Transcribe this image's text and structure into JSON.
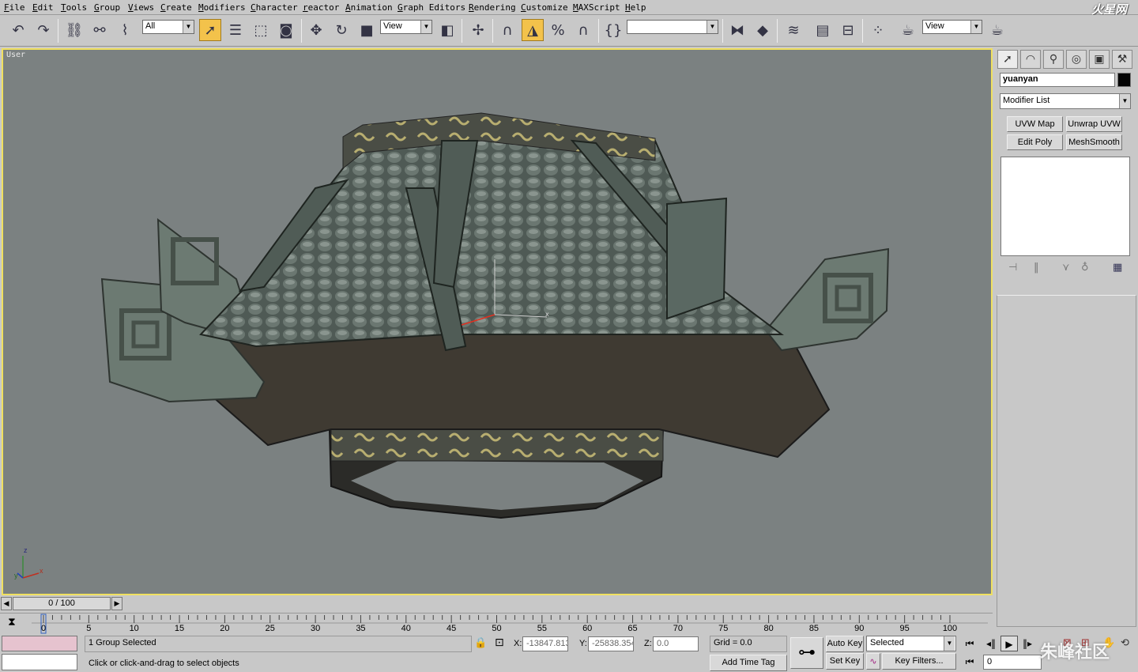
{
  "menu": [
    "File",
    "Edit",
    "Tools",
    "Group",
    "Views",
    "Create",
    "Modifiers",
    "Character",
    "reactor",
    "Animation",
    "Graph Editors",
    "Rendering",
    "Customize",
    "MAXScript",
    "Help"
  ],
  "logo_text": "火星网",
  "toolbar": {
    "selection_filter": "All",
    "ref_coord_1": "View",
    "named_sel": "",
    "ref_coord_2": "View",
    "icons": [
      "undo-icon",
      "redo-icon",
      "select-link-icon",
      "unlink-icon",
      "bind-space-warp-icon",
      "select-object-icon",
      "select-by-name-icon",
      "rect-region-icon",
      "window-crossing-icon",
      "move-icon",
      "rotate-icon",
      "scale-icon",
      "pivot-icon",
      "manipulate-icon",
      "snap-icon",
      "angle-snap-icon",
      "percent-snap-icon",
      "spinner-snap-icon",
      "edit-named-sel-icon",
      "mirror-icon",
      "align-icon",
      "layer-icon",
      "curve-editor-icon",
      "schematic-icon",
      "material-editor-icon",
      "render-scene-icon",
      "quick-render-icon"
    ]
  },
  "viewport": {
    "label": "User",
    "axis_x": "x",
    "axis_y": "y",
    "axis_z": "z"
  },
  "command_panel": {
    "object_name": "yuanyan",
    "object_color": "#050505",
    "modifier_list": "Modifier List",
    "modifier_buttons": [
      "UVW Map",
      "Unwrap UVW",
      "Edit Poly",
      "MeshSmooth"
    ]
  },
  "time_slider": {
    "label": "0 / 100",
    "current": 0,
    "total": 100
  },
  "track_ticks": [
    "0",
    "5",
    "10",
    "15",
    "20",
    "25",
    "30",
    "35",
    "40",
    "45",
    "50",
    "55",
    "60",
    "65",
    "70",
    "75",
    "80",
    "85",
    "90",
    "95",
    "100"
  ],
  "status": {
    "selection": "1 Group Selected",
    "prompt": "Click or click-and-drag to select objects",
    "x_label": "X:",
    "x_value": "-13847.813",
    "y_label": "Y:",
    "y_value": "-25838.354",
    "z_label": "Z:",
    "z_value": "0.0",
    "grid": "Grid = 0.0",
    "add_time_tag": "Add Time Tag",
    "auto_key": "Auto Key",
    "set_key": "Set Key",
    "key_mode": "Selected",
    "key_filters": "Key Filters...",
    "frame": "0"
  },
  "watermark": "朱峰社区"
}
